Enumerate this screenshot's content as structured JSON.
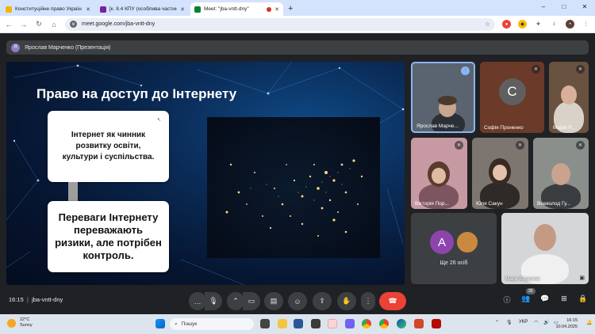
{
  "browser": {
    "tabs": [
      {
        "label": "Конституційне право Україн",
        "favicon_color": "#f4b400"
      },
      {
        "label": "[к. 8.4 КПУ (особлива частин",
        "favicon_color": "#7b1fa2"
      },
      {
        "label": "Meet: \"jba-vntt-dny\"",
        "favicon_color": "#00832d"
      }
    ],
    "new_tab": "+",
    "url": "meet.google.com/jba-vntt-dny",
    "window_controls": [
      "–",
      "□",
      "✕"
    ]
  },
  "meet": {
    "presenter_initial": "Я",
    "presenter_label": "Ярослав Марченко (Презентація)",
    "slide": {
      "title": "Право на доступ до Інтернету",
      "card1": "Інтернет як чинник розвитку освіти, культури і суспільства.",
      "card2": "Переваги Інтернету переважають ризики, але потрібен контроль."
    },
    "participants": [
      {
        "name": "Ярослав Марче...",
        "status": "speaking"
      },
      {
        "name": "Софія Проненко",
        "initial": "С",
        "status": "muted"
      },
      {
        "name": "Марія Р...",
        "status": "muted"
      },
      {
        "name": "Вікторія Пор...",
        "status": "muted"
      },
      {
        "name": "Юля Сакун",
        "status": "muted"
      },
      {
        "name": "Всеволод Гу...",
        "status": "muted"
      },
      {
        "name": "Ще 26 осіб",
        "initial": "A"
      },
      {
        "name": "Марк Воронов"
      }
    ],
    "meeting_time": "16:15",
    "meeting_code": "jba-vntt-dny",
    "people_count": "35"
  },
  "taskbar": {
    "temperature": "22°C",
    "weather": "Sunny",
    "search_placeholder": "Пошук",
    "language": "УКР",
    "time": "16:15",
    "date": "10.04.2025"
  }
}
